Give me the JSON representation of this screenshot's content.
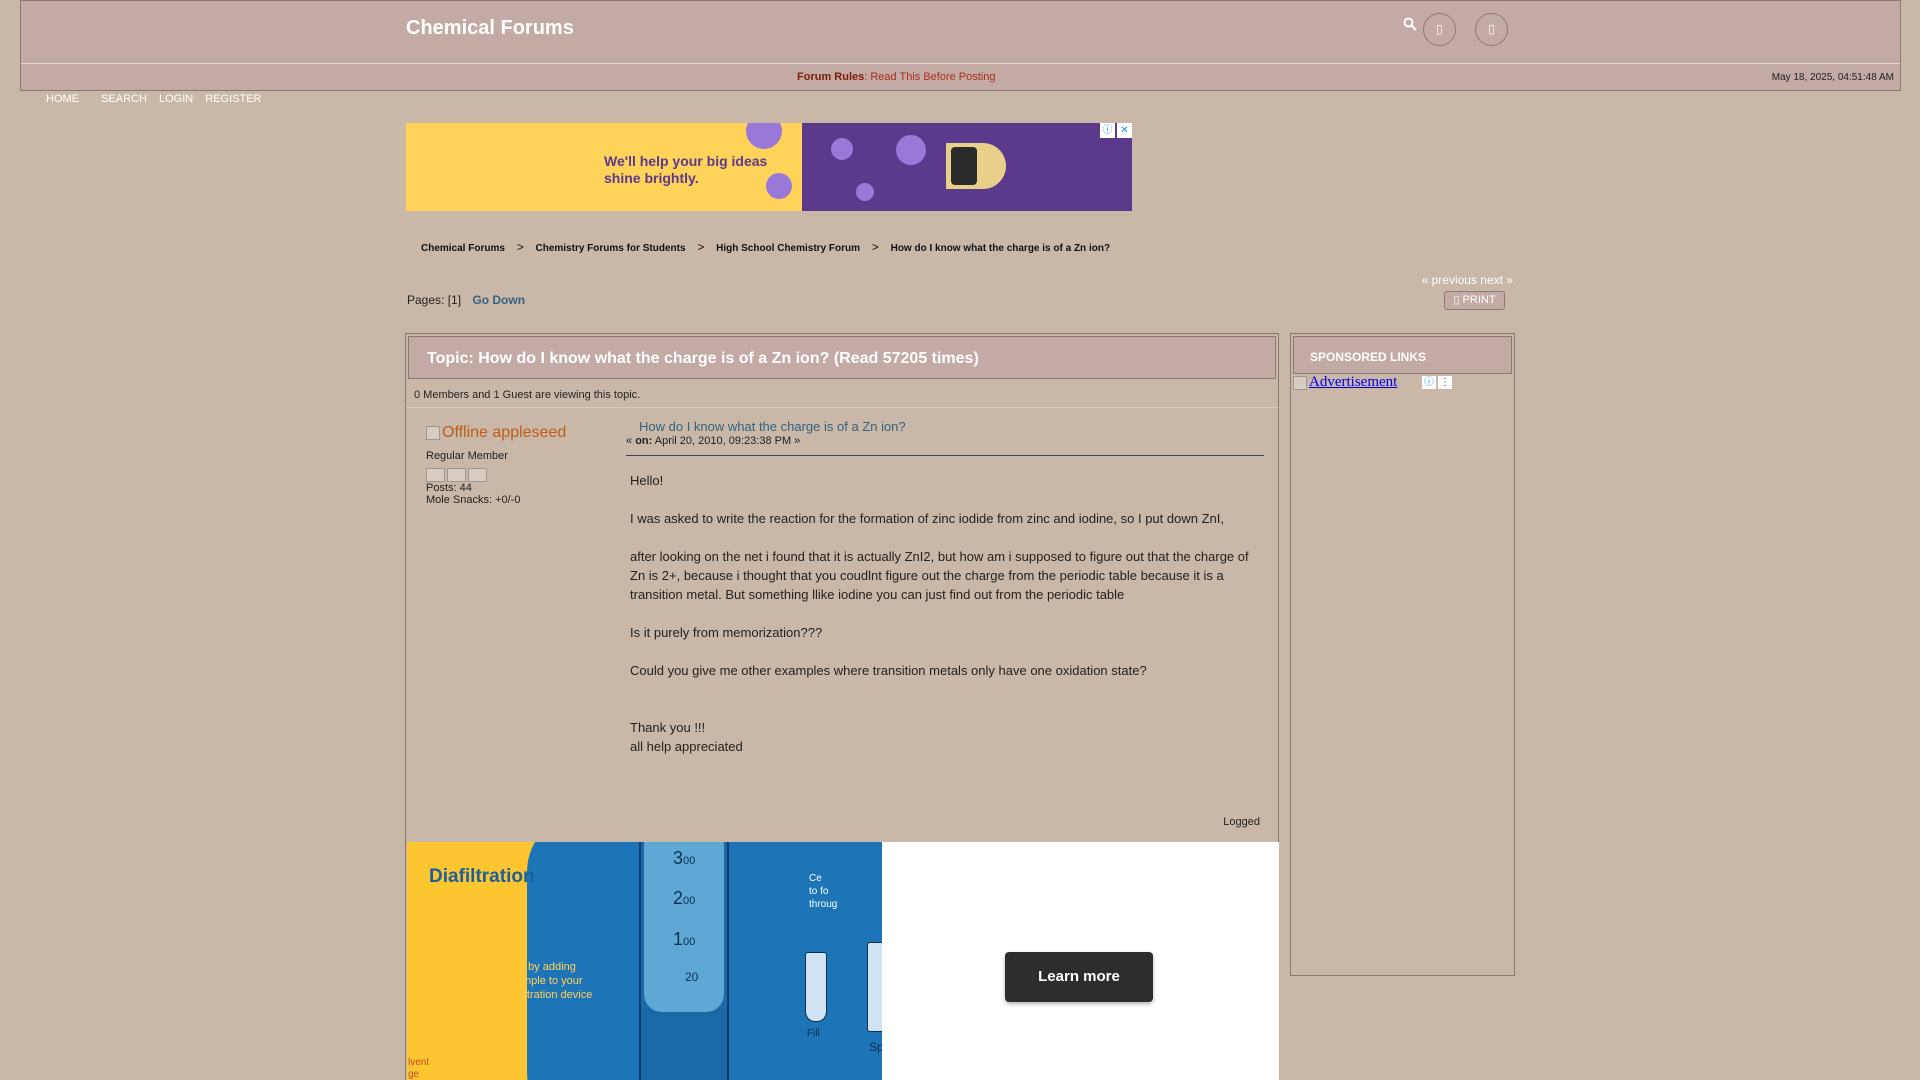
{
  "header": {
    "site_title": "Chemical Forums",
    "icons": [
      "search-icon",
      "user-icon",
      "settings-icon"
    ]
  },
  "rules": {
    "label": "Forum Rules",
    "text": ": Read This Before Posting"
  },
  "datetime": "May 18, 2025, 04:51:48 AM",
  "topnav": {
    "items": [
      "HOME",
      "SEARCH",
      "LOGIN",
      "REGISTER"
    ]
  },
  "ad_banner": {
    "text": "We'll help your big ideas shine brightly."
  },
  "breadcrumb": {
    "items": [
      "Chemical Forums",
      "Chemistry Forums for Students",
      "High School Chemistry Forum",
      "How do I know what the charge is of a Zn ion?"
    ],
    "separator": ">"
  },
  "nav": {
    "prev_next": "« previous next »",
    "print": "PRINT",
    "pages_label": "Pages:",
    "pages_value": "[1]",
    "go_down": "Go Down"
  },
  "topic": {
    "title": "Topic: How do I know what the charge is of a Zn ion?  (Read 57205 times)",
    "viewing": "0 Members and 1 Guest are viewing this topic."
  },
  "poster": {
    "name": "Offline appleseed",
    "role": "Regular Member",
    "posts": "Posts: 44",
    "snacks": "Mole Snacks: +0/-0"
  },
  "post": {
    "title": "How do I know what the charge is of a Zn ion?",
    "meta_prefix": "«",
    "meta_on": "on:",
    "meta_date": "April 20, 2010, 09:23:38 PM »",
    "paragraphs": [
      "Hello!",
      "I was asked to write the reaction for the formation of zinc iodide from zinc and iodine, so I put down ZnI,",
      "after looking on the net i found that it is actually ZnI2, but how am i supposed to figure out that the charge of Zn is 2+, because i thought that you coudlnt figure out the charge from the periodic table because it is a transition metal. But something llike iodine you can just find out from the periodic table",
      "Is it purely from memorization???",
      "Could you give me other examples where transition metals only have one oxidation state?"
    ],
    "closing1": "Thank you !!!",
    "closing2": "all help appreciated",
    "logged": "Logged"
  },
  "ad_diafiltration": {
    "title": "Diafiltration",
    "side_text": "t by adding\nmple to your\niltration device",
    "solvent": "lvent\nge",
    "center_text": "Ce\nto fo\nthroug",
    "fill": "Fill",
    "sp": "Sp",
    "learn_more": "Learn more",
    "scale": [
      "3",
      "2",
      "1",
      "20"
    ],
    "scale_sub": "00"
  },
  "sidebar": {
    "header": "SPONSORED LINKS",
    "ad_text": "Advertisement"
  }
}
